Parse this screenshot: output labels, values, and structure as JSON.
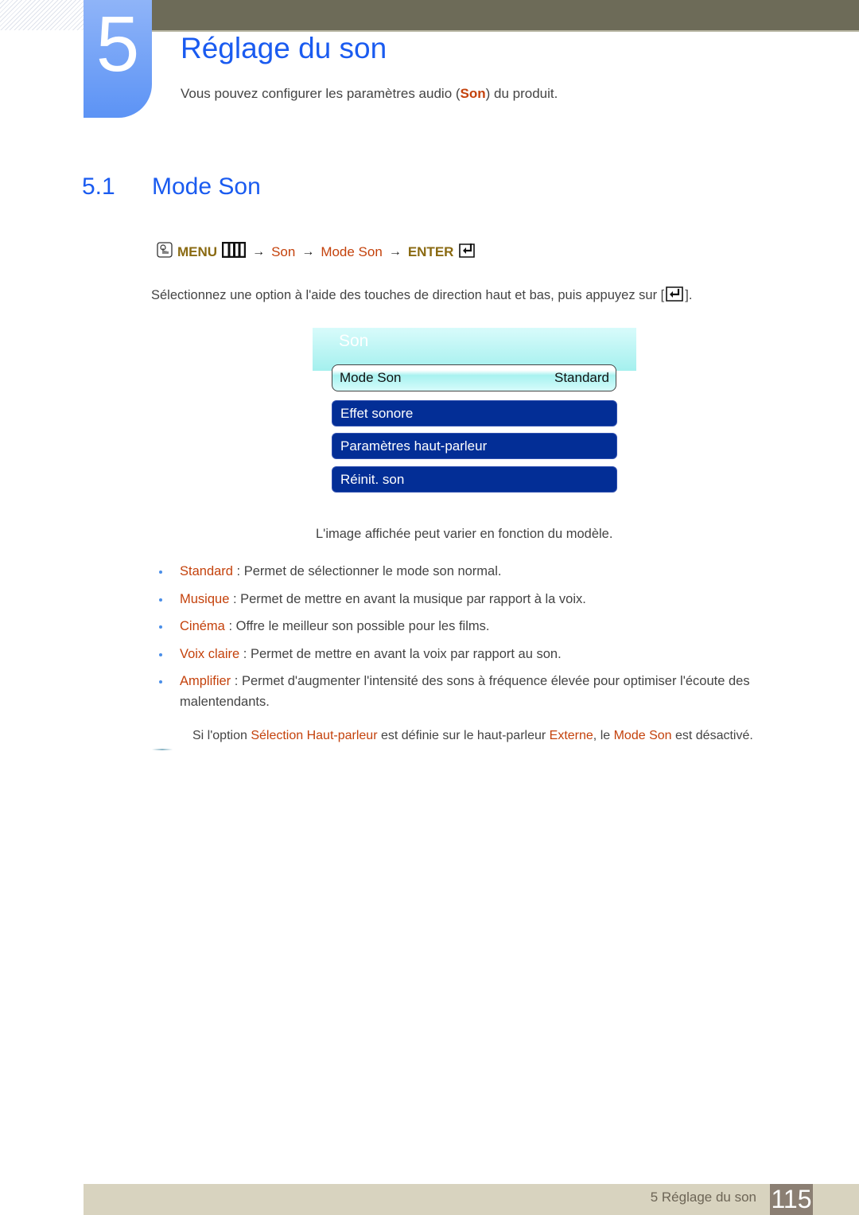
{
  "chapter": {
    "number": "5",
    "title": "Réglage du son",
    "intro_before": "Vous pouvez configurer les paramètres audio (",
    "intro_highlight": "Son",
    "intro_after": ") du produit."
  },
  "section": {
    "number": "5.1",
    "title": "Mode Son"
  },
  "menu_path": {
    "icon": "remote-hand-icon",
    "items": [
      "MENU",
      "Son",
      "Mode Son",
      "ENTER"
    ],
    "arrow": "→"
  },
  "instruction": {
    "text": "Sélectionnez une option à l'aide des touches de direction haut et bas, puis appuyez sur [",
    "end": "]."
  },
  "osd_menu": {
    "title": "Son",
    "selected": {
      "label": "Mode Son",
      "value": "Standard"
    },
    "items": [
      "Effet sonore",
      "Paramètres haut-parleur",
      "Réinit. son"
    ]
  },
  "caption": "L'image affichée peut varier en fonction du modèle.",
  "options": [
    {
      "term": "Standard",
      "desc": " : Permet de sélectionner le mode son normal."
    },
    {
      "term": "Musique",
      "desc": " : Permet de mettre en avant la musique par rapport à la voix."
    },
    {
      "term": "Cinéma",
      "desc": " : Offre le meilleur son possible pour les films."
    },
    {
      "term": "Voix claire",
      "desc": " : Permet de mettre en avant la voix par rapport au son."
    },
    {
      "term": "Amplifier",
      "desc": " : Permet d'augmenter l'intensité des sons à fréquence élevée pour optimiser l'écoute des malentendants."
    }
  ],
  "note": {
    "p1": "Si l'option ",
    "h1": "Sélection Haut-parleur",
    "p2": " est définie sur le haut-parleur ",
    "h2": "Externe",
    "p3": ", le ",
    "h3": "Mode Son",
    "p4": " est désactivé."
  },
  "footer": {
    "chapter_label": "5 Réglage du son",
    "page_number": "115"
  },
  "colors": {
    "heading_blue": "#1a5bf0",
    "highlight_orange": "#c4420c",
    "menu_gold": "#8a6a12",
    "osd_item_blue": "#032e96",
    "top_bar": "#6d6b58",
    "footer_bar": "#d8d3bf",
    "page_box": "#8b7f73"
  }
}
